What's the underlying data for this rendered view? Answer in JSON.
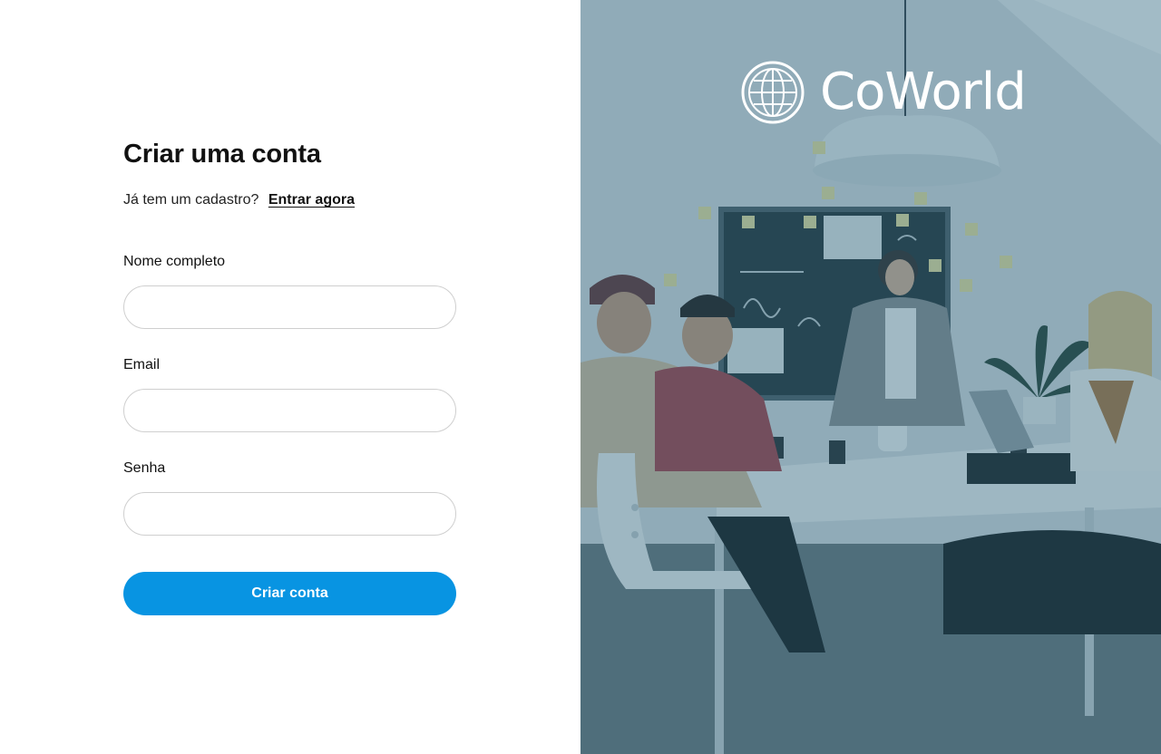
{
  "form": {
    "title": "Criar uma conta",
    "login_prompt": "Já tem um cadastro?",
    "login_link": "Entrar agora",
    "fields": [
      {
        "label": "Nome completo",
        "value": "",
        "placeholder": ""
      },
      {
        "label": "Email",
        "value": "",
        "placeholder": ""
      },
      {
        "label": "Senha",
        "value": "",
        "placeholder": ""
      }
    ],
    "submit_label": "Criar conta"
  },
  "brand": {
    "name": "CoWorld",
    "logo_icon": "globe-icon"
  },
  "colors": {
    "primary_button": "#0894e2",
    "image_overlay": "#1c5a73"
  }
}
